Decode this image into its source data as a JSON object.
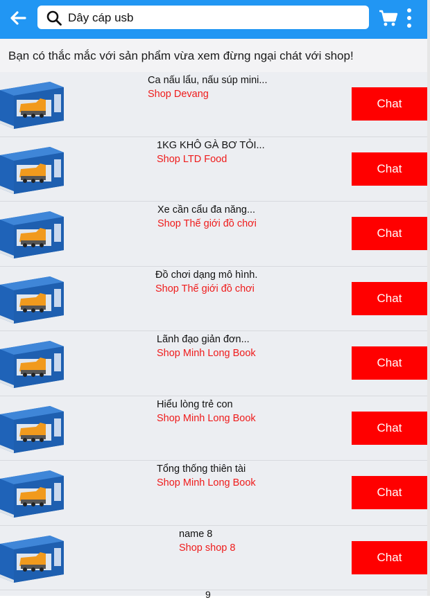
{
  "header": {
    "search_value": "Dây cáp usb",
    "accent_color": "#2196f3",
    "icons": [
      "arrow-left-icon",
      "search-icon",
      "cart-icon",
      "more-vertical-icon"
    ]
  },
  "notice": {
    "text": "Bạn có thắc mắc với sản phẩm vừa xem đừng ngại chát với shop!"
  },
  "items": [
    {
      "name": "Ca nấu lẩu, nấu súp mini...",
      "shop": "Shop Devang",
      "chat_label": "Chat"
    },
    {
      "name": "1KG KHÔ GÀ BƠ TỎI...",
      "shop": "Shop LTD Food",
      "chat_label": "Chat"
    },
    {
      "name": "Xe cần cẩu đa năng...",
      "shop": "Shop Thế giới đồ chơi",
      "chat_label": "Chat"
    },
    {
      "name": "Đồ chơi dạng mô hình.",
      "shop": "Shop Thế giới đồ chơi",
      "chat_label": "Chat"
    },
    {
      "name": "Lãnh đạo giản đơn...",
      "shop": "Shop Minh Long Book",
      "chat_label": "Chat"
    },
    {
      "name": "Hiểu lòng trẻ con",
      "shop": "Shop Minh Long Book",
      "chat_label": "Chat"
    },
    {
      "name": "Tổng thống thiên tài",
      "shop": "Shop Minh Long Book",
      "chat_label": "Chat"
    },
    {
      "name": "name 8",
      "shop": "Shop shop 8",
      "chat_label": "Chat"
    }
  ],
  "partial_next_item_text": "9",
  "colors": {
    "chat_button": "#ff0000",
    "shop_text": "#ef1b1b",
    "list_background": "#eceef2"
  }
}
